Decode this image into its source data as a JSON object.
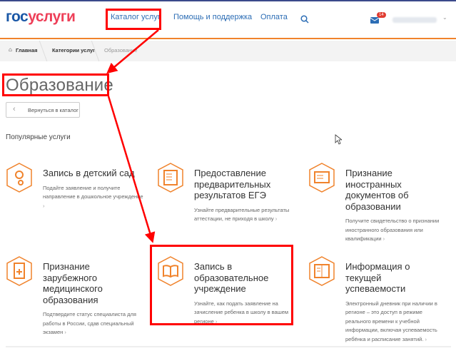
{
  "header": {
    "logo_part1": "гос",
    "logo_part2": "услуги",
    "nav": [
      "Каталог услуг",
      "Помощь и поддержка",
      "Оплата"
    ],
    "mail_badge": "14"
  },
  "breadcrumb": [
    "Главная",
    "Категории услуг",
    "Образование"
  ],
  "page_title": "Образование",
  "back_button": "Вернуться в каталог",
  "section_title": "Популярные услуги",
  "cards": [
    {
      "title": "Запись в детский сад",
      "desc": "Подайте заявление и получите направление в дошкольное учреждение",
      "icon": "pacifier-icon"
    },
    {
      "title": "Предоставление предварительных результатов ЕГЭ",
      "desc": "Узнайте предварительные результаты аттестации, не приходя в школу",
      "icon": "ege-document-icon"
    },
    {
      "title": "Признание иностранных документов об образовании",
      "desc": "Получите свидетельство о признании иностранного образования или квалификации",
      "icon": "document-icon"
    },
    {
      "title": "Признание зарубежного медицинского образования",
      "desc": "Подтвердите статус специалиста для работы в России, сдав специальный экзамен",
      "icon": "medical-document-icon"
    },
    {
      "title": "Запись в образовательное учреждение",
      "desc": "Узнайте, как подать заявление на зачисление ребенка в школу в вашем регионе",
      "icon": "book-icon"
    },
    {
      "title": "Информация о текущей успеваемости",
      "desc": "Электронный дневник при наличии в регионе – это доступ в режиме реального времени к учебной информации, включая успеваемость ребёнка и расписание занятий.",
      "icon": "diary-icon"
    }
  ],
  "colors": {
    "accent": "#f0832c",
    "annotation": "#ff0000",
    "link": "#2c6db5"
  }
}
